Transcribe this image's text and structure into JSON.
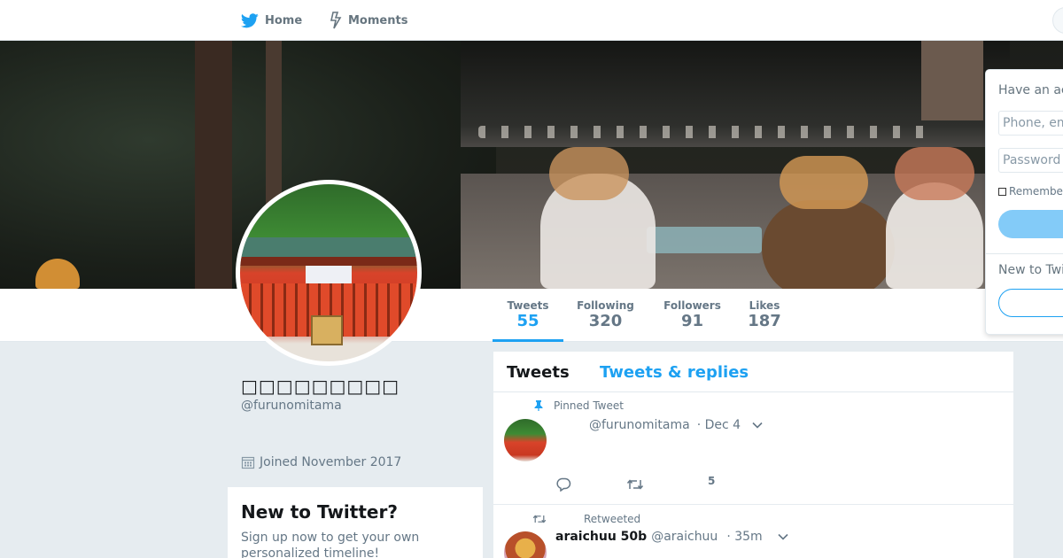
{
  "nav": {
    "home_label": "Home",
    "moments_label": "Moments",
    "home_icon": "twitter-bird-icon",
    "moments_icon": "lightning-icon"
  },
  "profile": {
    "name": "□□□□□□□□□",
    "handle": "@furunomitama",
    "joined": "Joined November 2017"
  },
  "stats": [
    {
      "label": "Tweets",
      "value": "55"
    },
    {
      "label": "Following",
      "value": "320"
    },
    {
      "label": "Followers",
      "value": "91"
    },
    {
      "label": "Likes",
      "value": "187"
    }
  ],
  "timeline": {
    "tabs": [
      "Tweets",
      "Tweets & replies"
    ],
    "pinned_label": "Pinned Tweet",
    "pinned_tweet": {
      "handle": "@furunomitama",
      "date": "· Dec 4",
      "like_count": "5"
    },
    "retweet": {
      "label": "Retweeted",
      "name": "araichuu 50b",
      "handle": "@araichuu",
      "time": "· 35m"
    }
  },
  "signup_card": {
    "title": "New to Twitter?",
    "text": "Sign up now to get your own personalized timeline!"
  },
  "login": {
    "title": "Have an account?",
    "phone_placeholder": "Phone, email or username",
    "password_placeholder": "Password",
    "remember": "Remember me",
    "new_prompt": "New to Twitter?"
  },
  "colors": {
    "accent": "#1da1f2",
    "background": "#e6ecf0"
  }
}
